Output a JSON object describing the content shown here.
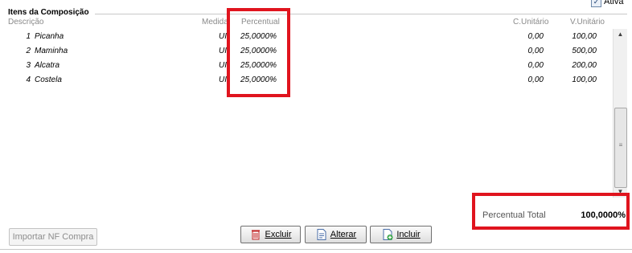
{
  "header": {
    "group_title": "Itens da Composição",
    "ativa_label": "Ativa",
    "ativa_checked": true
  },
  "columns": {
    "descricao": "Descrição",
    "medida": "Medida",
    "percentual": "Percentual",
    "c_unitario": "C.Unitário",
    "v_unitario": "V.Unitário"
  },
  "rows": [
    {
      "n": "1",
      "desc": "Picanha",
      "medida": "UI",
      "percentual": "25,0000%",
      "c_unit": "0,00",
      "v_unit": "100,00"
    },
    {
      "n": "2",
      "desc": "Maminha",
      "medida": "UI",
      "percentual": "25,0000%",
      "c_unit": "0,00",
      "v_unit": "500,00"
    },
    {
      "n": "3",
      "desc": "Alcatra",
      "medida": "UI",
      "percentual": "25,0000%",
      "c_unit": "0,00",
      "v_unit": "200,00"
    },
    {
      "n": "4",
      "desc": "Costela",
      "medida": "UI",
      "percentual": "25,0000%",
      "c_unit": "0,00",
      "v_unit": "100,00"
    }
  ],
  "summary": {
    "total_label": "Percentual Total",
    "total_value": "100,0000%"
  },
  "buttons": {
    "importar": "Importar NF Compra",
    "excluir": "Excluir",
    "alterar": "Alterar",
    "incluir": "Incluir"
  },
  "colors": {
    "highlight": "#e0141e"
  },
  "icons": {
    "excluir": "trash-icon",
    "alterar": "document-edit-icon",
    "incluir": "document-add-icon"
  }
}
